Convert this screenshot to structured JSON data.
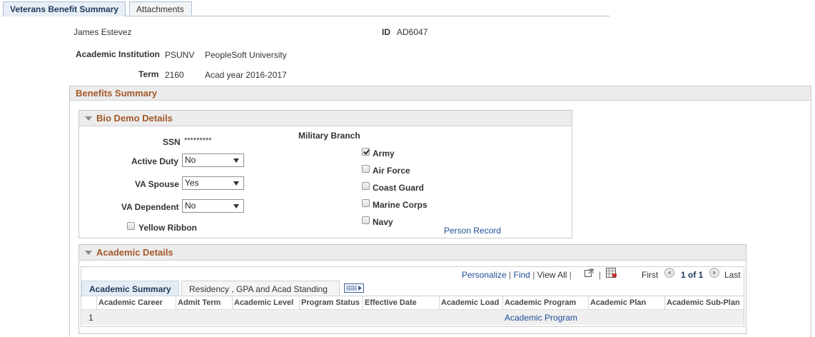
{
  "tabs": [
    {
      "label": "Veterans Benefit Summary"
    },
    {
      "label": "Attachments"
    }
  ],
  "header": {
    "name": "James Estevez",
    "id_label": "ID",
    "id_value": "AD6047",
    "institution_label": "Academic Institution",
    "institution_code": "PSUNV",
    "institution_name": "PeopleSoft University",
    "term_label": "Term",
    "term_code": "2160",
    "term_desc": "Acad year 2016-2017"
  },
  "benefits_summary": {
    "title": "Benefits Summary"
  },
  "bio_demo": {
    "title": "Bio Demo Details",
    "ssn_label": "SSN",
    "ssn_value": "*********",
    "active_duty_label": "Active Duty",
    "active_duty_value": "No",
    "va_spouse_label": "VA Spouse",
    "va_spouse_value": "Yes",
    "va_dependent_label": "VA Dependent",
    "va_dependent_value": "No",
    "yellow_ribbon_label": "Yellow Ribbon",
    "military_branch_label": "Military Branch",
    "branches": [
      {
        "label": "Army",
        "checked": true
      },
      {
        "label": "Air Force",
        "checked": false
      },
      {
        "label": "Coast Guard",
        "checked": false
      },
      {
        "label": "Marine Corps",
        "checked": false
      },
      {
        "label": "Navy",
        "checked": false
      }
    ],
    "person_record_link": "Person Record"
  },
  "academic_details": {
    "title": "Academic Details",
    "toolbar": {
      "personalize": "Personalize",
      "find": "Find",
      "view_all": "View All",
      "first": "First",
      "page_info": "1 of 1",
      "last": "Last"
    },
    "grid_tabs": [
      {
        "label": "Academic Summary"
      },
      {
        "label": "Residency , GPA and Acad Standing"
      }
    ],
    "columns": [
      "Academic Career",
      "Admit Term",
      "Academic Level",
      "Program Status",
      "Effective Date",
      "Academic Load",
      "Academic Program",
      "Academic Plan",
      "Academic Sub-Plan"
    ],
    "rows": [
      {
        "row_num": "1",
        "academic_program": "Academic Program"
      }
    ]
  },
  "colors": {
    "section_title": "#a4582a",
    "link": "#1f4e96"
  }
}
